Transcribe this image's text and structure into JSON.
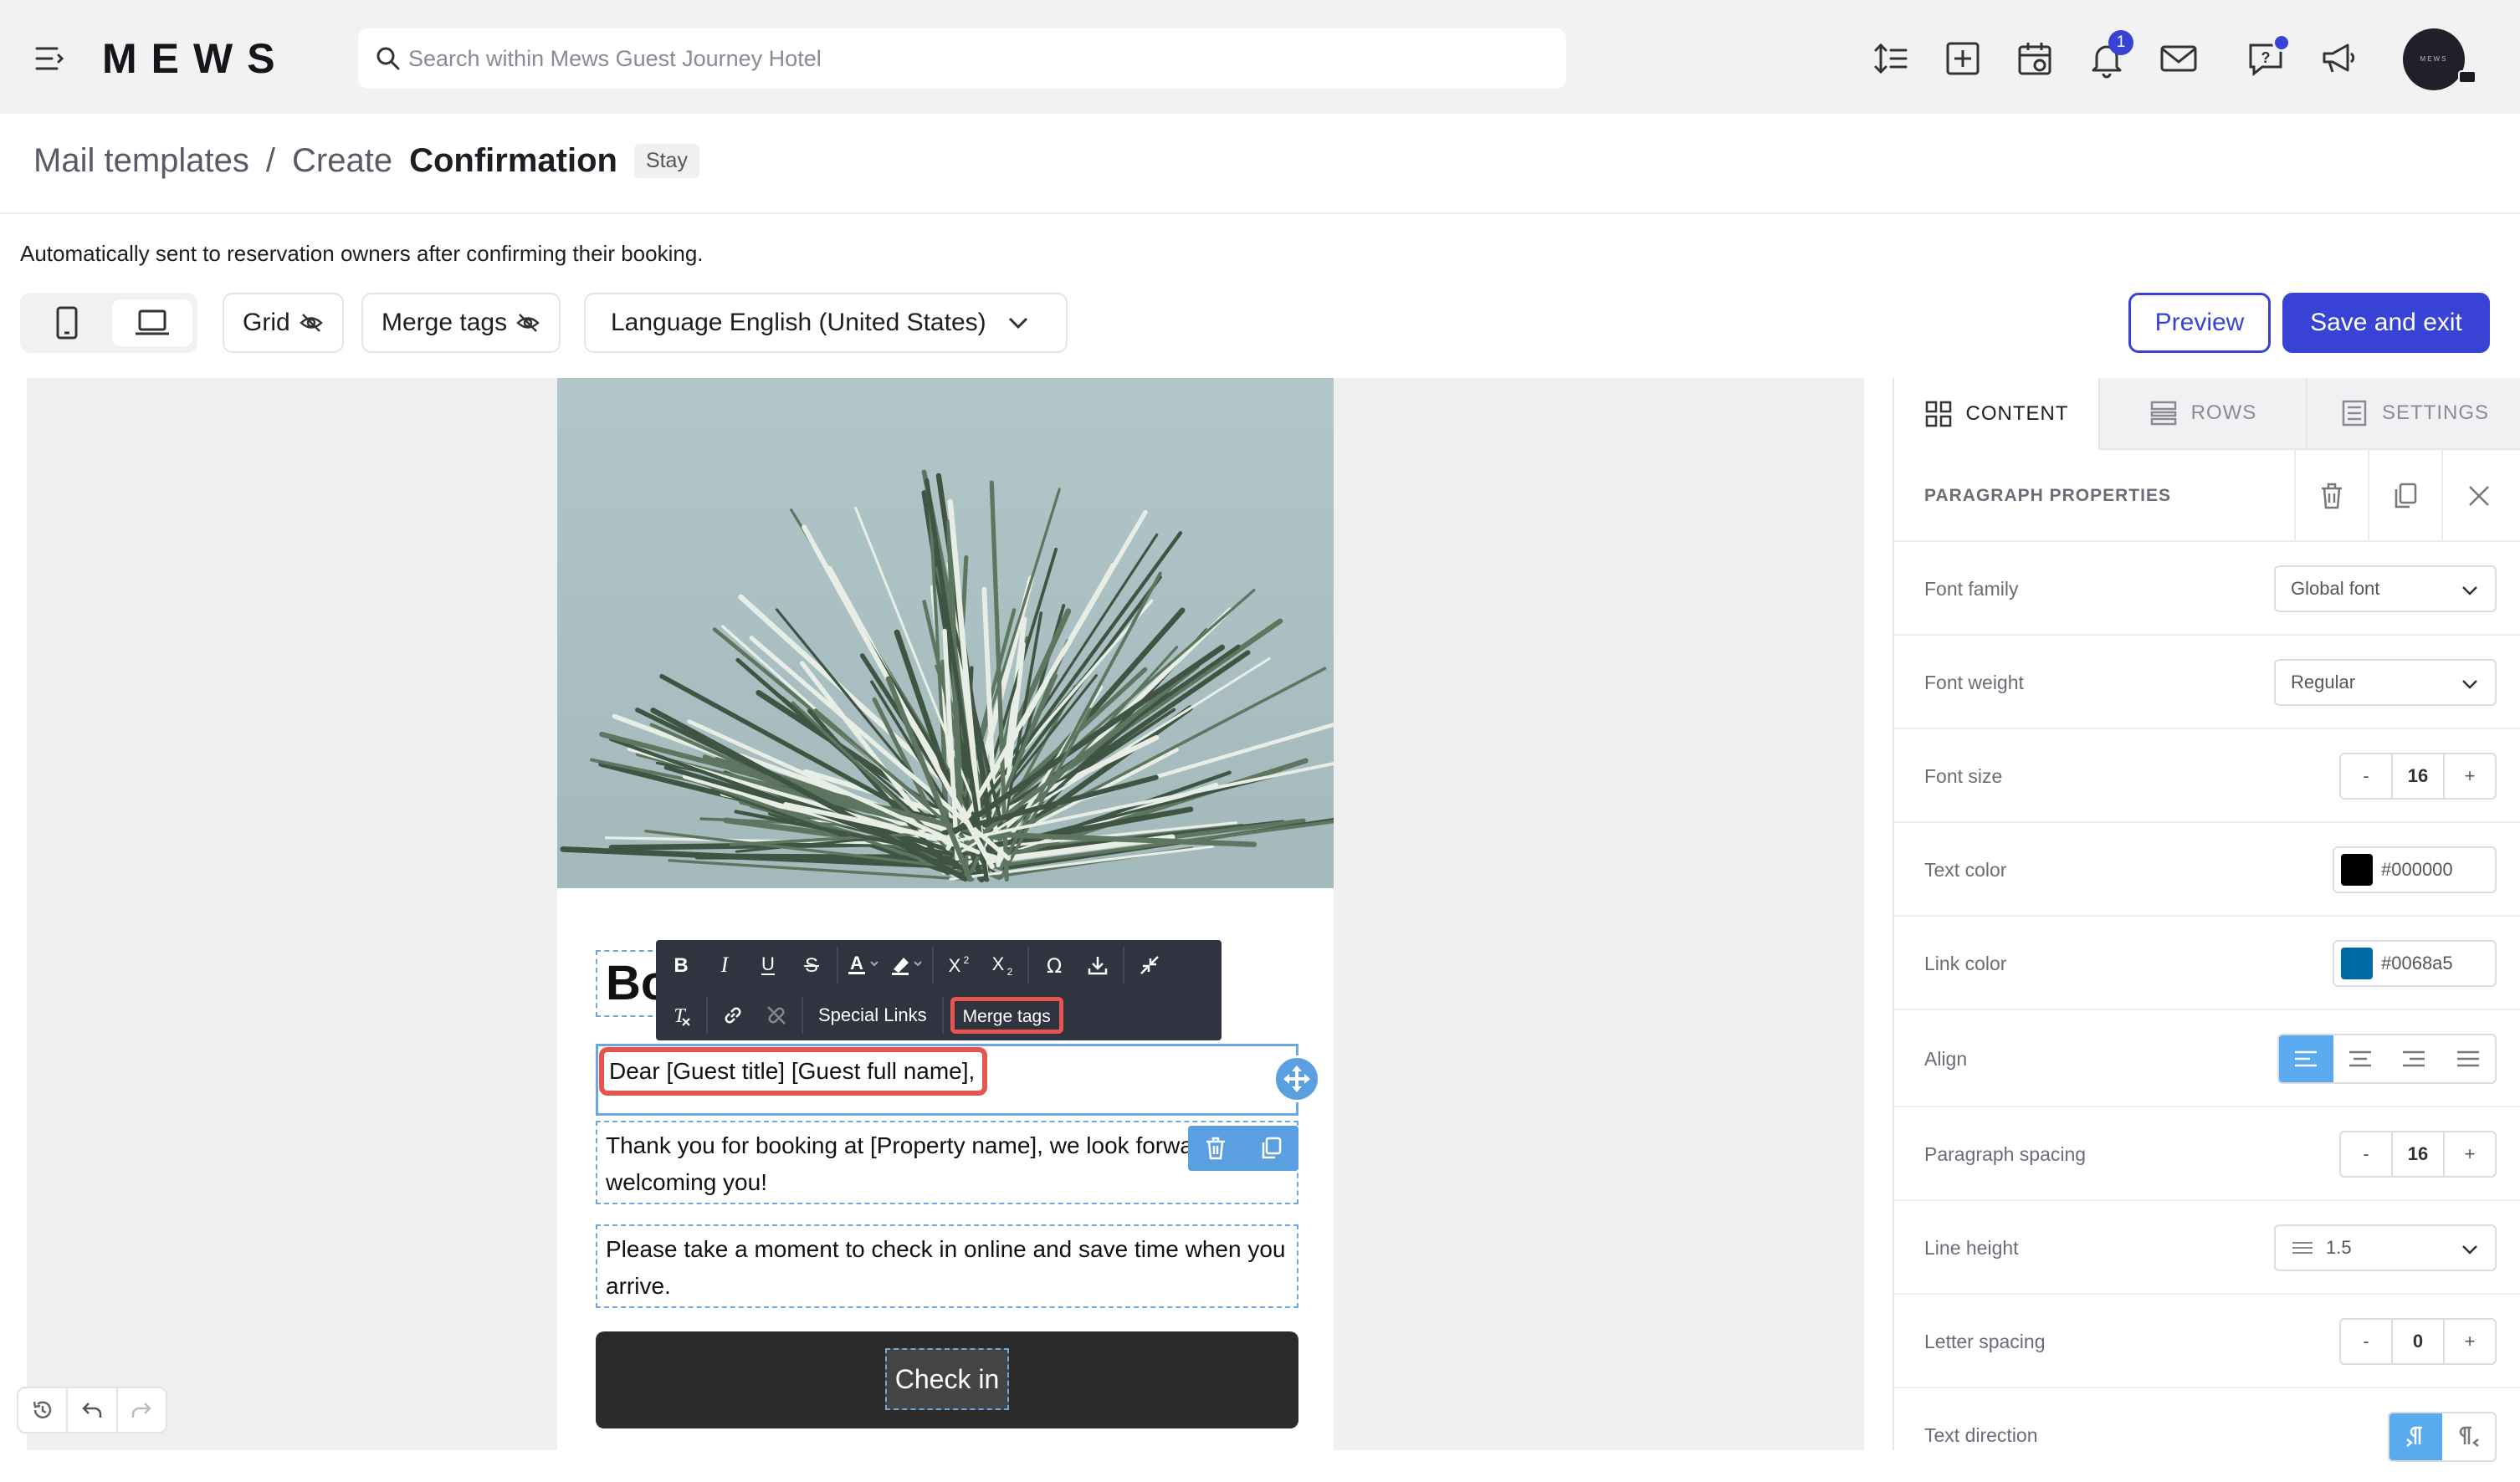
{
  "topbar": {
    "logo": "MEWS",
    "search_placeholder": "Search within Mews Guest Journey Hotel",
    "notification_count": "1",
    "avatar_text": "MEWS"
  },
  "header": {
    "breadcrumb_root": "Mail templates",
    "separator": "/",
    "action": "Create",
    "title": "Confirmation",
    "badge": "Stay",
    "description": "Automatically sent to reservation owners after confirming their booking."
  },
  "toolbar": {
    "grid_label": "Grid",
    "merge_tags_label": "Merge tags",
    "language_label": "Language English (United States)",
    "preview_label": "Preview",
    "save_label": "Save and exit"
  },
  "editor": {
    "heading_text": "Bo",
    "rte_special_links": "Special Links",
    "rte_merge_tags": "Merge tags",
    "paragraph_1": "Dear [Guest title] [Guest full name],",
    "paragraph_2": "Thank you for booking at [Property name], we look forward to welcoming you!",
    "paragraph_3": "Please take a moment to check in online and save time when you arrive.",
    "button_label": "Check in"
  },
  "panel": {
    "tabs": [
      {
        "label": "CONTENT",
        "active": true
      },
      {
        "label": "ROWS",
        "active": false
      },
      {
        "label": "SETTINGS",
        "active": false
      }
    ],
    "section_title": "PARAGRAPH PROPERTIES",
    "properties": {
      "font_family": {
        "label": "Font family",
        "value": "Global font"
      },
      "font_weight": {
        "label": "Font weight",
        "value": "Regular"
      },
      "font_size": {
        "label": "Font size",
        "value": "16"
      },
      "text_color": {
        "label": "Text color",
        "value": "#000000"
      },
      "link_color": {
        "label": "Link color",
        "value": "#0068a5"
      },
      "align": {
        "label": "Align",
        "value": "left"
      },
      "paragraph_spacing": {
        "label": "Paragraph spacing",
        "value": "16"
      },
      "line_height": {
        "label": "Line height",
        "value": "1.5"
      },
      "letter_spacing": {
        "label": "Letter spacing",
        "value": "0"
      },
      "text_direction": {
        "label": "Text direction",
        "value": "ltr"
      }
    },
    "stepper_minus": "-",
    "stepper_plus": "+"
  },
  "colors": {
    "accent": "#3843d6",
    "highlight": "#e6564f",
    "selection": "#5aaaf0"
  }
}
